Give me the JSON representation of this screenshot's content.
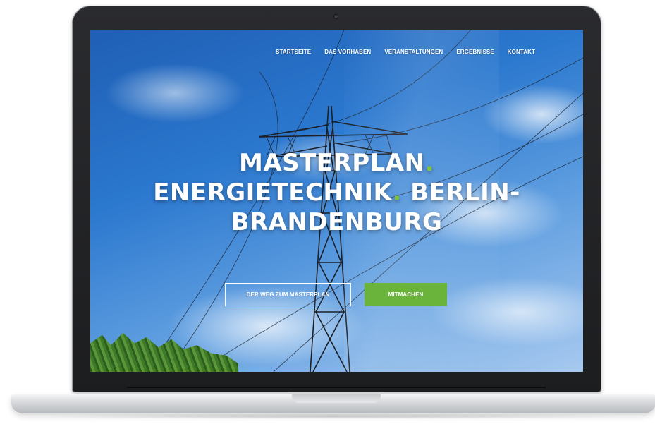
{
  "nav": {
    "items": [
      {
        "label": "STARTSEITE"
      },
      {
        "label": "DAS VORHABEN"
      },
      {
        "label": "VERANSTALTUNGEN"
      },
      {
        "label": "ERGEBNISSE"
      },
      {
        "label": "KONTAKT"
      }
    ]
  },
  "hero": {
    "line1": "MASTERPLAN",
    "line2a": "ENERGIETECHNIK",
    "line2b": "BERLIN-",
    "line3": "BRANDENBURG",
    "dot": ".",
    "accent_color": "#7fc241"
  },
  "buttons": {
    "secondary_label": "DER WEG ZUM MASTERPLAN",
    "primary_label": "MITMACHEN",
    "primary_color": "#6ab43c"
  }
}
